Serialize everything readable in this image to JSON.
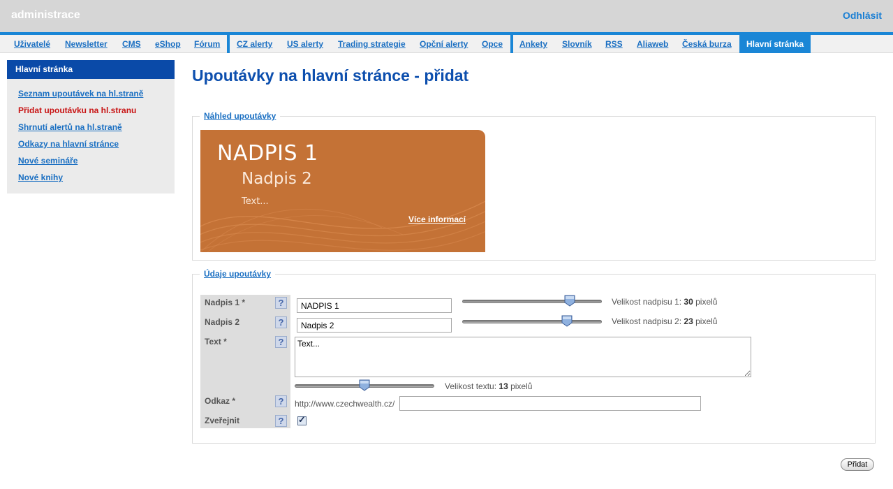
{
  "header": {
    "title": "administrace",
    "logout": "Odhlásit"
  },
  "nav": {
    "items": [
      {
        "label": "Uživatelé"
      },
      {
        "label": "Newsletter"
      },
      {
        "label": "CMS"
      },
      {
        "label": "eShop"
      },
      {
        "label": "Fórum"
      },
      {
        "label": "CZ alerty"
      },
      {
        "label": "US alerty"
      },
      {
        "label": "Trading strategie"
      },
      {
        "label": "Opční alerty"
      },
      {
        "label": "Opce"
      },
      {
        "label": "Ankety"
      },
      {
        "label": "Slovník"
      },
      {
        "label": "RSS"
      },
      {
        "label": "Aliaweb"
      },
      {
        "label": "Česká burza"
      },
      {
        "label": "Hlavní stránka",
        "active": true
      }
    ]
  },
  "sidebar": {
    "title": "Hlavní stránka",
    "items": [
      {
        "label": "Seznam upoutávek na hl.straně"
      },
      {
        "label": "Přidat upoutávku na hl.stranu",
        "current": true
      },
      {
        "label": "Shrnutí alertů na hl.straně"
      },
      {
        "label": "Odkazy na hlavní stránce"
      },
      {
        "label": "Nové semináře"
      },
      {
        "label": "Nové knihy"
      }
    ]
  },
  "main": {
    "title": "Upoutávky na hlavní stránce - přidat",
    "preview": {
      "legend": "Náhled upoutávky",
      "heading1": "NADPIS 1",
      "heading2": "Nadpis 2",
      "text": "Text...",
      "more_link": "Více informací",
      "colors": {
        "background": "#c47236"
      }
    },
    "form": {
      "legend": "Údaje upoutávky",
      "help_label": "?",
      "heading1": {
        "label": "Nadpis 1 *",
        "value": "NADPIS 1",
        "size_caption_prefix": "Velikost nadpisu 1:",
        "size_value": "30",
        "size_unit": "pixelů",
        "slider_level": 0.77
      },
      "heading2": {
        "label": "Nadpis 2",
        "value": "Nadpis 2",
        "size_caption_prefix": "Velikost nadpisu 2:",
        "size_value": "23",
        "size_unit": "pixelů",
        "slider_level": 0.75
      },
      "text": {
        "label": "Text *",
        "value": "Text...",
        "size_caption_prefix": "Velikost textu:",
        "size_value": "13",
        "size_unit": "pixelů",
        "slider_level": 0.5
      },
      "link": {
        "label": "Odkaz *",
        "prefix": "http://www.czechwealth.cz/",
        "value": ""
      },
      "publish": {
        "label": "Zveřejnit",
        "checked": true
      },
      "submit_label": "Přidat"
    }
  }
}
